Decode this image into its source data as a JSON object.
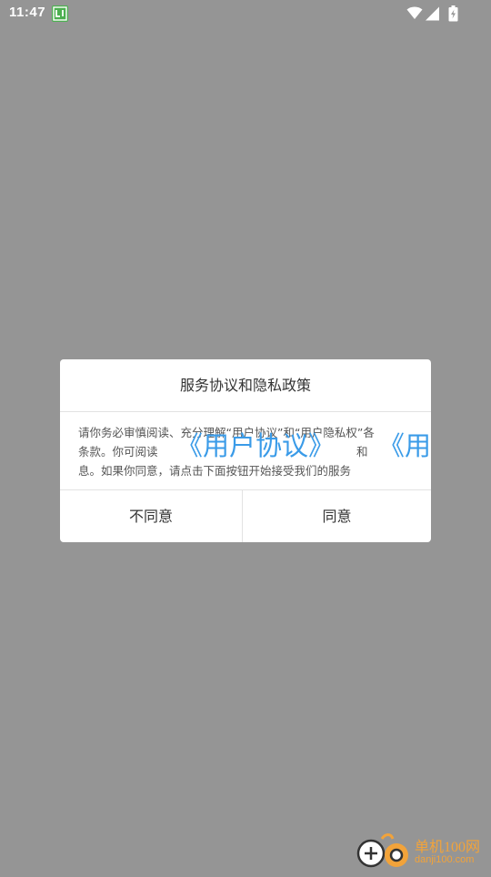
{
  "status_bar": {
    "time": "11:47"
  },
  "dialog": {
    "title": "服务协议和隐私政策",
    "body_line1": "请你务必审慎阅读、充分理解“用户协议”和“用户隐私权”各",
    "body_line2": "条款。你可阅读",
    "body_link1": "《用户协议》",
    "body_and": "和",
    "body_link2": "《用",
    "body_line3": "息。如果你同意，请点击下面按钮开始接受我们的服务",
    "disagree_label": "不同意",
    "agree_label": "同意"
  },
  "watermark": {
    "brand": "单机100网",
    "domain": "danji100.com"
  },
  "colors": {
    "overlay": "#959595",
    "dialog_bg": "#ffffff",
    "link": "#3a9be8",
    "watermark": "#f2a33a",
    "app_icon": "#4caf50"
  },
  "icons": {
    "status_app": "launcher-app-icon",
    "wifi": "wifi-icon",
    "signal": "cell-signal-icon",
    "battery": "battery-charging-icon",
    "watermark_logo": "danji100-logo"
  }
}
